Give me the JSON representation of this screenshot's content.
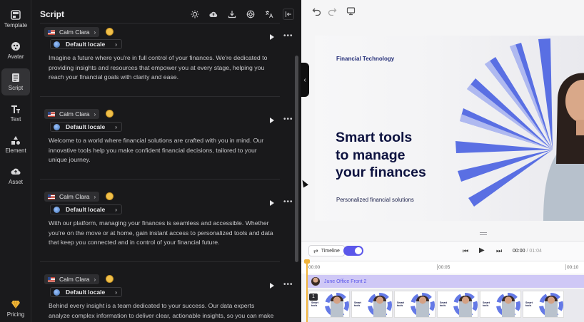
{
  "sidebar": {
    "items": [
      {
        "label": "Template",
        "icon": "template-icon"
      },
      {
        "label": "Avatar",
        "icon": "avatar-icon"
      },
      {
        "label": "Script",
        "icon": "script-icon",
        "active": true
      },
      {
        "label": "Text",
        "icon": "text-icon"
      },
      {
        "label": "Element",
        "icon": "element-icon"
      },
      {
        "label": "Asset",
        "icon": "asset-icon"
      }
    ],
    "pricing": {
      "label": "Pricing",
      "icon": "gem-icon"
    }
  },
  "script": {
    "title": "Script",
    "toolbar_icons": [
      "lightbulb-icon",
      "cloud-upload-icon",
      "download-icon",
      "settings-dial-icon",
      "translate-icon",
      "collapse-left-icon"
    ],
    "cards": [
      {
        "voice": "Calm Clara",
        "locale": "Default locale",
        "text": "Imagine a future where you're in full control of your finances. We're dedicated to providing insights and resources that empower you at every stage, helping you reach your financial goals with clarity and ease."
      },
      {
        "voice": "Calm Clara",
        "locale": "Default locale",
        "text": "Welcome to a world where financial solutions are crafted with you in mind. Our innovative tools help you make confident financial decisions, tailored to your unique journey."
      },
      {
        "voice": "Calm Clara",
        "locale": "Default locale",
        "text": "With our platform, managing your finances is seamless and accessible. Whether you're on the move or at home, gain instant access to personalized tools and data that keep you connected and in control of your financial future."
      },
      {
        "voice": "Calm Clara",
        "locale": "Default locale",
        "text": "Behind every insight is a team dedicated to your success. Our data experts analyze complex information to deliver clear, actionable insights, so you can make decisions"
      }
    ]
  },
  "canvas": {
    "eyebrow": "Financial Technology",
    "headline_lines": [
      "Smart tools",
      "to manage",
      "your finances"
    ],
    "subtitle": "Personalized financial solutions",
    "colors": {
      "accent": "#4a62e2",
      "headline": "#0e1340"
    }
  },
  "timeline": {
    "button_label": "Timeline",
    "current_time": "00:00",
    "total_time": "/ 01:04",
    "ruler_labels": [
      "00:00",
      "00:05",
      "00:10"
    ],
    "avatar_track_label": "June Office Front 2",
    "scene_number": "1",
    "toggle_color": "#5b57ea"
  }
}
